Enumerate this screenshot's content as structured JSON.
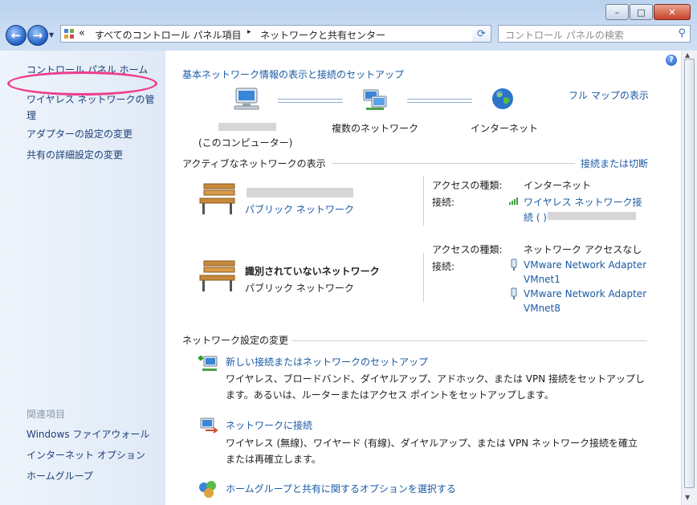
{
  "address": {
    "chevrons": "«",
    "crumbs": [
      "すべてのコントロール パネル項目",
      "ネットワークと共有センター"
    ],
    "separator": "▸"
  },
  "search": {
    "placeholder": "コントロール パネルの検索"
  },
  "sidebar": {
    "links": [
      "コントロール パネル ホーム",
      "ワイヤレス ネットワークの管理",
      "アダプターの設定の変更",
      "共有の詳細設定の変更"
    ],
    "see_also_heading": "関連項目",
    "see_also": [
      "Windows ファイアウォール",
      "インターネット オプション",
      "ホームグループ"
    ]
  },
  "header": {
    "title": "基本ネットワーク情報の表示と接続のセットアップ",
    "full_map": "フル マップの表示"
  },
  "map": {
    "computer_label": "(このコンピューター)",
    "multi_network": "複数のネットワーク",
    "internet": "インターネット"
  },
  "active": {
    "heading": "アクティブなネットワークの表示",
    "connect_link": "接続または切断",
    "networks": [
      {
        "name": "",
        "type": "パブリック ネットワーク",
        "access_label": "アクセスの種類:",
        "access_value": "インターネット",
        "conn_label": "接続:",
        "conn_value_line1": "ワイヤレス ネットワーク接",
        "conn_value_line2": "続 (                          )"
      },
      {
        "name": "識別されていないネットワーク",
        "type": "パブリック ネットワーク",
        "access_label": "アクセスの種類:",
        "access_value": "ネットワーク アクセスなし",
        "conn_label": "接続:",
        "adapters": [
          [
            "VMware Network Adapter",
            "VMnet1"
          ],
          [
            "VMware Network Adapter",
            "VMnet8"
          ]
        ]
      }
    ]
  },
  "settings": {
    "heading": "ネットワーク設定の変更",
    "items": [
      {
        "link": "新しい接続またはネットワークのセットアップ",
        "desc1": "ワイヤレス、ブロードバンド、ダイヤルアップ、アドホック、または VPN 接続をセットアップし",
        "desc2": "ます。あるいは、ルーターまたはアクセス ポイントをセットアップします。"
      },
      {
        "link": "ネットワークに接続",
        "desc1": "ワイヤレス (無線)、ワイヤード (有線)、ダイヤルアップ、または VPN ネットワーク接続を確立",
        "desc2": "または再確立します。"
      },
      {
        "link": "ホームグループと共有に関するオプションを選択する"
      }
    ]
  },
  "colors": {
    "link": "#1a5aa5",
    "highlight": "#ef3d8c",
    "sidebar": "#e6eef8"
  }
}
